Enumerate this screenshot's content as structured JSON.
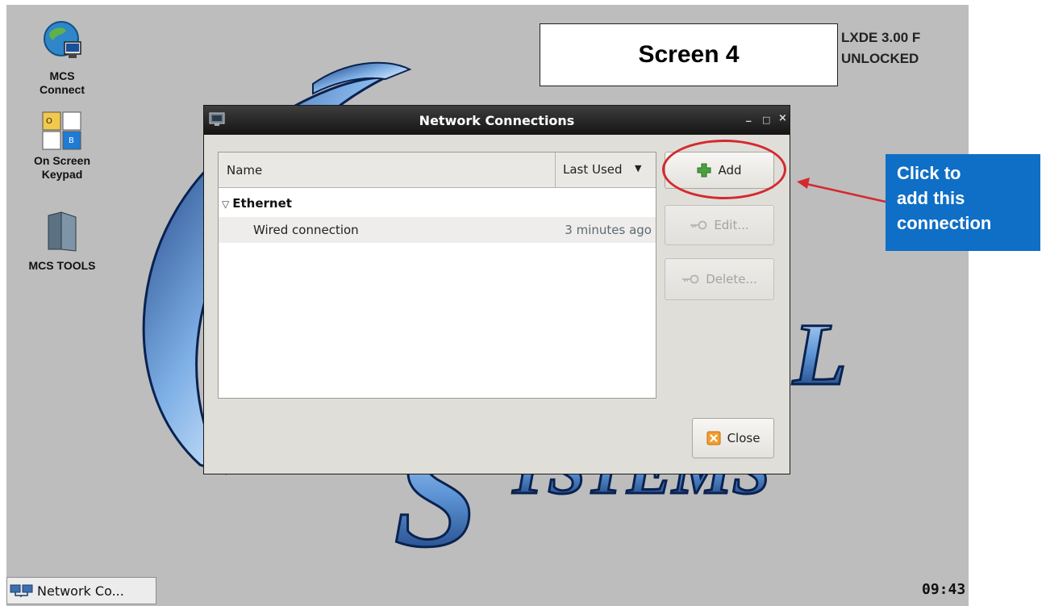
{
  "desktop": {
    "icons": [
      {
        "label": "MCS\nConnect",
        "icon": "globe-computer-icon"
      },
      {
        "label": "On Screen\nKeypad",
        "icon": "keypad-icon",
        "keys": [
          "O",
          "B"
        ]
      },
      {
        "label": "MCS TOOLS",
        "icon": "folder-icon"
      }
    ],
    "version_line1": "LXDE 3.00 F",
    "version_line2": "UNLOCKED",
    "wallpaper_letters": [
      "L",
      "S",
      "YSTEMS"
    ]
  },
  "annotation": {
    "screen_label": "Screen 4",
    "callout_text": "Click to\nadd this\nconnection",
    "highlight_color": "#d32a2f",
    "callout_color": "#0f6fc6"
  },
  "dialog": {
    "title": "Network Connections",
    "window_buttons": [
      "_",
      "□",
      "×"
    ],
    "list": {
      "columns": [
        "Name",
        "Last Used"
      ],
      "sort_indicator": "▼",
      "groups": [
        {
          "name": "Ethernet",
          "expander": "▽",
          "connections": [
            {
              "name": "Wired connection",
              "last_used": "3 minutes ago"
            }
          ]
        }
      ]
    },
    "buttons": {
      "add": "Add",
      "edit": "Edit...",
      "delete": "Delete...",
      "close": "Close"
    }
  },
  "taskbar": {
    "task_label": "Network Co...",
    "clock": "09:43"
  }
}
